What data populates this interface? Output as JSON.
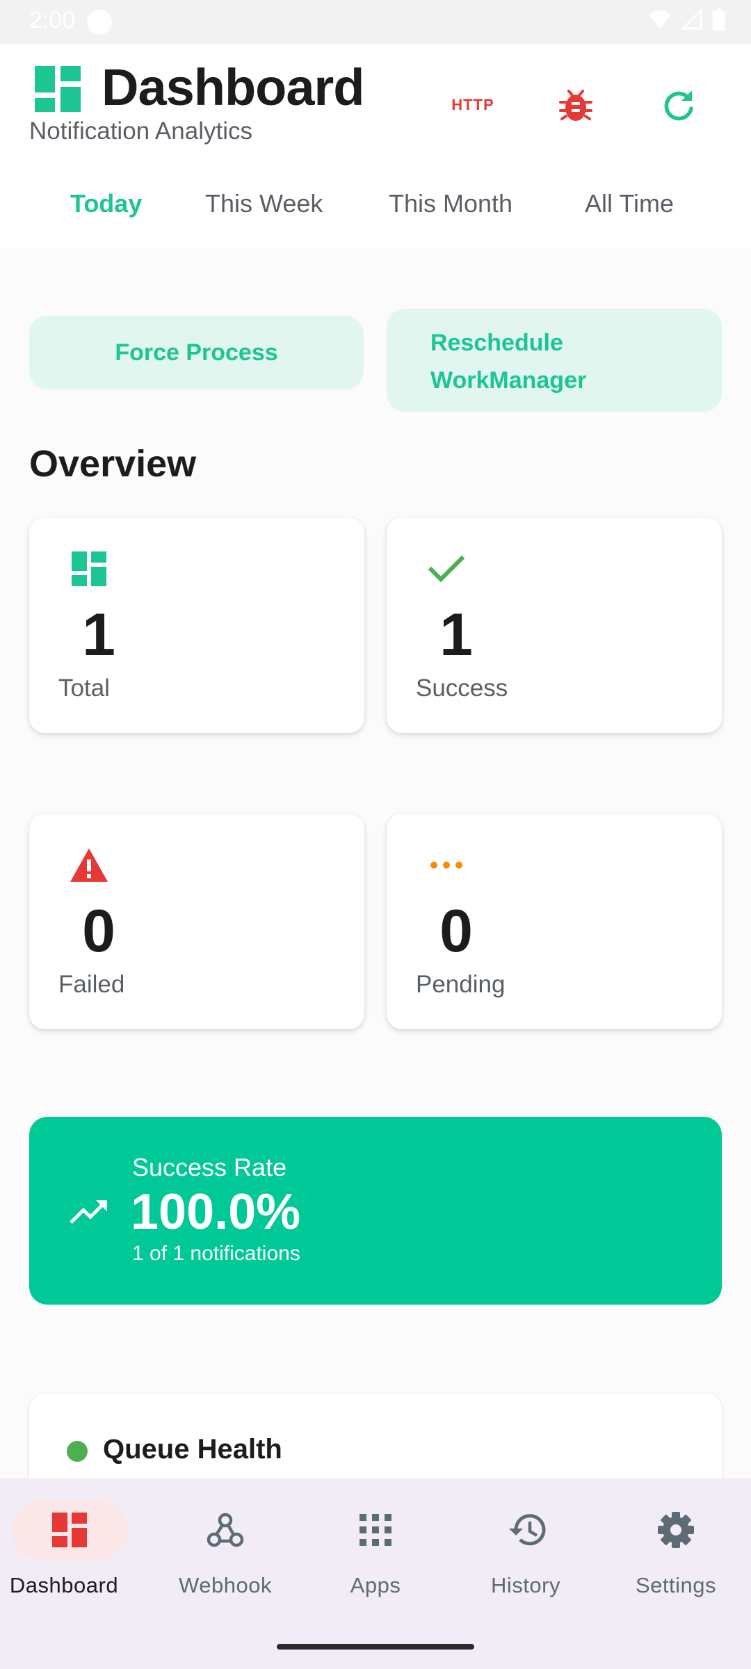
{
  "status_bar": {
    "time": "2:00"
  },
  "header": {
    "title": "Dashboard",
    "subtitle": "Notification Analytics",
    "http_label": "HTTP"
  },
  "tabs": [
    {
      "label": "Today",
      "active": true
    },
    {
      "label": "This Week",
      "active": false
    },
    {
      "label": "This Month",
      "active": false
    },
    {
      "label": "All Time",
      "active": false
    }
  ],
  "actions": {
    "force_process": "Force Process",
    "reschedule_line1": "Reschedule",
    "reschedule_line2": "WorkManager"
  },
  "overview": {
    "title": "Overview",
    "cards": {
      "total": {
        "value": "1",
        "label": "Total",
        "icon": "dashboard-icon",
        "color": "#1ec594"
      },
      "success": {
        "value": "1",
        "label": "Success",
        "icon": "check-icon",
        "color": "#4caf50"
      },
      "failed": {
        "value": "0",
        "label": "Failed",
        "icon": "warning-icon",
        "color": "#e53935"
      },
      "pending": {
        "value": "0",
        "label": "Pending",
        "icon": "more-horiz-icon",
        "color": "#fb8c00"
      }
    }
  },
  "success_rate": {
    "label": "Success Rate",
    "value": "100.0%",
    "detail": "1 of 1 notifications",
    "color": "#00c896"
  },
  "queue_health": {
    "title": "Queue Health",
    "status_color": "#4caf50"
  },
  "bottom_nav": [
    {
      "label": "Dashboard",
      "icon": "dashboard-icon",
      "active": true
    },
    {
      "label": "Webhook",
      "icon": "webhook-icon",
      "active": false
    },
    {
      "label": "Apps",
      "icon": "apps-grid-icon",
      "active": false
    },
    {
      "label": "History",
      "icon": "history-icon",
      "active": false
    },
    {
      "label": "Settings",
      "icon": "gear-icon",
      "active": false
    }
  ],
  "colors": {
    "accent": "#1ec594",
    "error": "#e53935",
    "nav_background": "#f2ecf6"
  }
}
